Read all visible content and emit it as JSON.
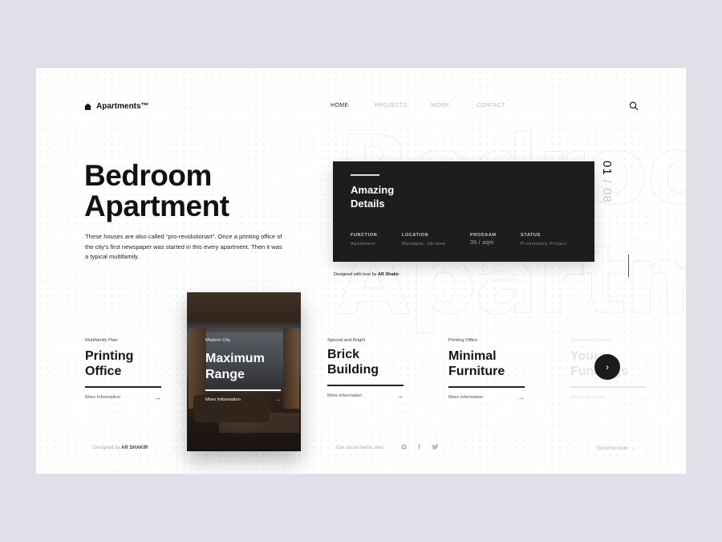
{
  "brand": {
    "name": "Apartments™",
    "icon": "house-icon"
  },
  "nav": {
    "items": [
      "HOME",
      "PROJECTS",
      "WORK",
      "CONTACT"
    ],
    "active": "HOME",
    "search_icon": "search-icon"
  },
  "background_words": [
    "Bedroom",
    "Apartment"
  ],
  "hero": {
    "title_line1": "Bedroom",
    "title_line2": "Apartment",
    "description": "These houses are also called “pro-revolutionart”. Once a printing office of the city’s first newspaper was started in this every apartment. Then it was a typical multifamily."
  },
  "detail_card": {
    "title_line1": "Amazing",
    "title_line2": "Details",
    "meta": [
      {
        "label": "FUNCTION",
        "value": "Apartment"
      },
      {
        "label": "LOCATION",
        "value": "Maniapol, Ukraine"
      },
      {
        "label": "PRODAAM",
        "value": "35 / aqm"
      },
      {
        "label": "STATUS",
        "value": "Proliminary Project"
      }
    ]
  },
  "credit": {
    "prefix": "Designed with love by",
    "author": "AR Shakir"
  },
  "counter": {
    "current": "01",
    "separator": " / ",
    "total": "08"
  },
  "items": [
    {
      "subtitle": "Multifamily Plan",
      "title_line1": "Printing",
      "title_line2": "Office",
      "link": "More Information",
      "arrow": "→"
    },
    {
      "subtitle": "Modern City",
      "title_line1": "Maximum",
      "title_line2": "Range",
      "link": "More Information",
      "arrow": "→"
    },
    {
      "subtitle": "Special and Bright",
      "title_line1": "Brick",
      "title_line2": "Building",
      "link": "More information",
      "arrow": "→"
    },
    {
      "subtitle": "Printing Office",
      "title_line1": "Minimal",
      "title_line2": "Furniture",
      "link": "More information",
      "arrow": "→"
    },
    {
      "subtitle": "Specialist for Design",
      "title_line1": "Your",
      "title_line2": "Fundings",
      "link": "More information",
      "arrow": "→"
    }
  ],
  "next_button": {
    "glyph": "›"
  },
  "footer": {
    "designed_prefix": "Designed by",
    "designed_author": "AR SHAKIR",
    "social_label": "Our social media sites",
    "social_icons": [
      "instagram-icon",
      "facebook-icon",
      "twitter-icon"
    ],
    "scroll_label": "Scroll for more",
    "scroll_glyph": "⌄"
  },
  "colors": {
    "page_bg": "#dfe0e8",
    "frame_bg": "#ffffff",
    "card_bg": "#1d1d1f",
    "text": "#111111",
    "muted": "#b8b8b8"
  }
}
